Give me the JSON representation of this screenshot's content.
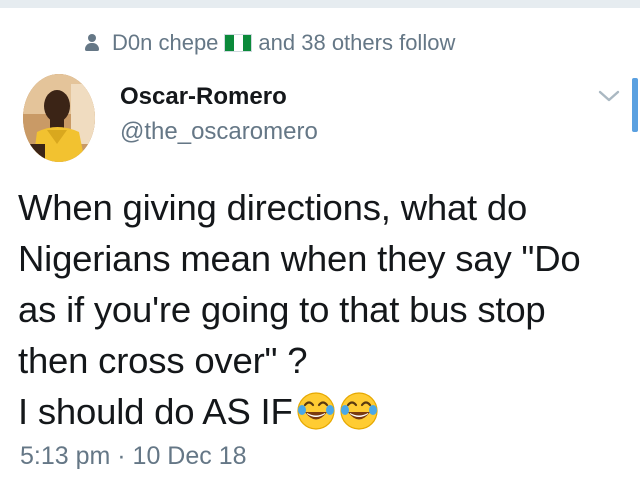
{
  "social_context": {
    "icon": "person-icon",
    "user": "D0n chepe",
    "flag": "nigeria-flag",
    "suffix": "and 38 others follow"
  },
  "author": {
    "display_name": "Oscar-Romero",
    "handle": "@the_oscaromero"
  },
  "tweet": {
    "lines": [
      "When giving directions, what do",
      "Nigerians mean when they say \"Do",
      "as if you're going to that bus stop",
      "then cross over\" ?",
      "I should do AS IF"
    ],
    "emojis": [
      "face-with-tears-of-joy",
      "face-with-tears-of-joy"
    ]
  },
  "timestamp": "5:13 pm · 10 Dec 18",
  "colors": {
    "secondary": "#657786",
    "text": "#14171a",
    "accent": "#5aa0e0",
    "flag_green": "#0b8a3a"
  }
}
